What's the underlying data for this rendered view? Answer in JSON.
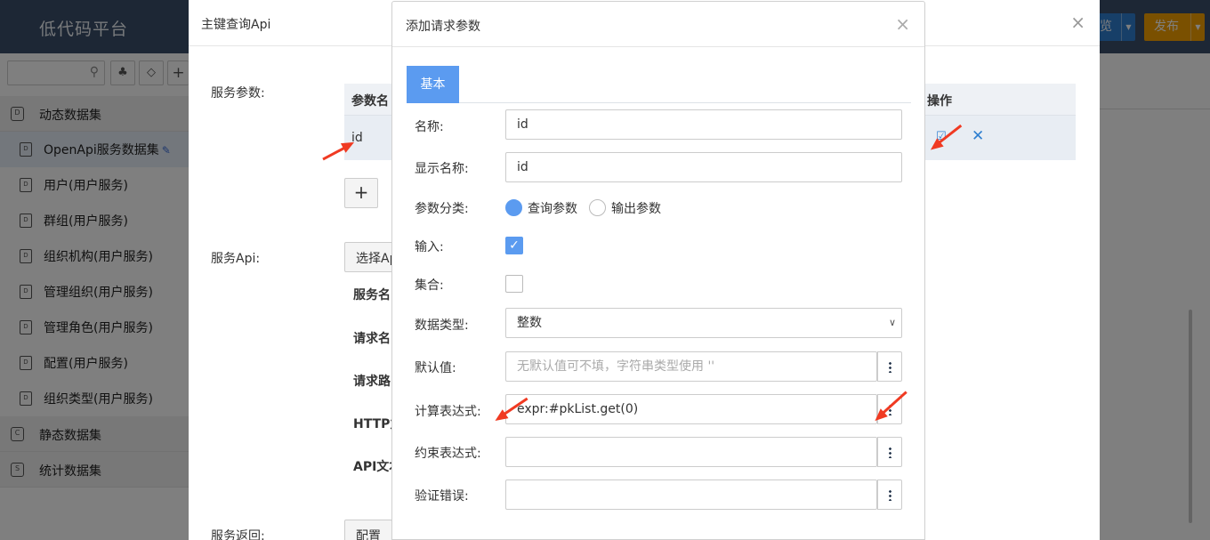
{
  "app": {
    "title": "低代码平台",
    "preview_label": "览",
    "publish_label": "发布"
  },
  "sidebar": {
    "search_placeholder": "",
    "groups": [
      {
        "label": "动态数据集",
        "icon": "D"
      },
      {
        "label": "静态数据集",
        "icon": "C"
      },
      {
        "label": "统计数据集",
        "icon": "S"
      }
    ],
    "items": [
      {
        "label": "OpenApi服务数据集",
        "active": true
      },
      {
        "label": "用户(用户服务)"
      },
      {
        "label": "群组(用户服务)"
      },
      {
        "label": "组织机构(用户服务)"
      },
      {
        "label": "管理组织(用户服务)"
      },
      {
        "label": "管理角色(用户服务)"
      },
      {
        "label": "配置(用户服务)"
      },
      {
        "label": "组织类型(用户服务)"
      }
    ]
  },
  "modal_api": {
    "title": "主键查询Api",
    "service_params_label": "服务参数:",
    "table_headers": [
      "参数名",
      "操作"
    ],
    "rows": [
      {
        "name": "id"
      }
    ],
    "service_api_label": "服务Api:",
    "select_api_label": "选择Ap",
    "fields": [
      "服务名",
      "请求名",
      "请求路",
      "HTTP力",
      "API文本"
    ],
    "service_return_label": "服务返回:",
    "config_label": "配置"
  },
  "modal_param": {
    "title": "添加请求参数",
    "tab_basic": "基本",
    "labels": {
      "name": "名称:",
      "display_name": "显示名称:",
      "category": "参数分类:",
      "input": "输入:",
      "collection": "集合:",
      "data_type": "数据类型:",
      "default_value": "默认值:",
      "calc_expr": "计算表达式:",
      "constraint_expr": "约束表达式:",
      "validation_error": "验证错误:"
    },
    "values": {
      "name": "id",
      "display_name": "id",
      "data_type": "整数",
      "calc_expr": "expr:#pkList.get(0)",
      "constraint_expr": "",
      "validation_error": ""
    },
    "placeholders": {
      "default_value": "无默认值可不填，字符串类型使用 ''"
    },
    "category_options": [
      {
        "label": "查询参数",
        "selected": true
      },
      {
        "label": "输出参数",
        "selected": false
      }
    ],
    "input_checked": true,
    "collection_checked": false
  },
  "colors": {
    "accent": "#5b9bf0",
    "topbar": "#3a4f6a",
    "publish": "#f5a100",
    "annotation_arrow": "#f03a22"
  }
}
